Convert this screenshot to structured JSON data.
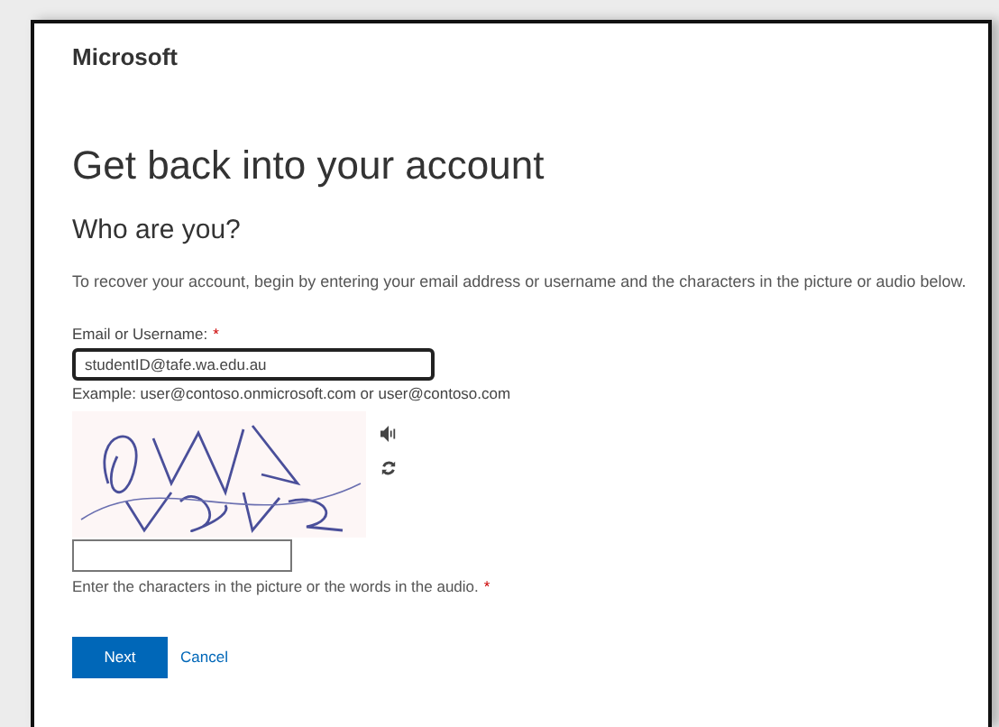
{
  "brand": "Microsoft",
  "title": "Get back into your account",
  "subtitle": "Who are you?",
  "description": "To recover your account, begin by entering your email address or username and the characters in the picture or audio below.",
  "email_field": {
    "label": "Email or Username:",
    "required_mark": "*",
    "value": "studentID@tafe.wa.edu.au",
    "hint": "Example: user@contoso.onmicrosoft.com or user@contoso.com"
  },
  "captcha_field": {
    "hint": "Enter the characters in the picture or the words in the audio.",
    "required_mark": "*"
  },
  "buttons": [
    {
      "kind": "primary",
      "label": "Next"
    },
    {
      "kind": "link",
      "label": "Cancel"
    }
  ]
}
